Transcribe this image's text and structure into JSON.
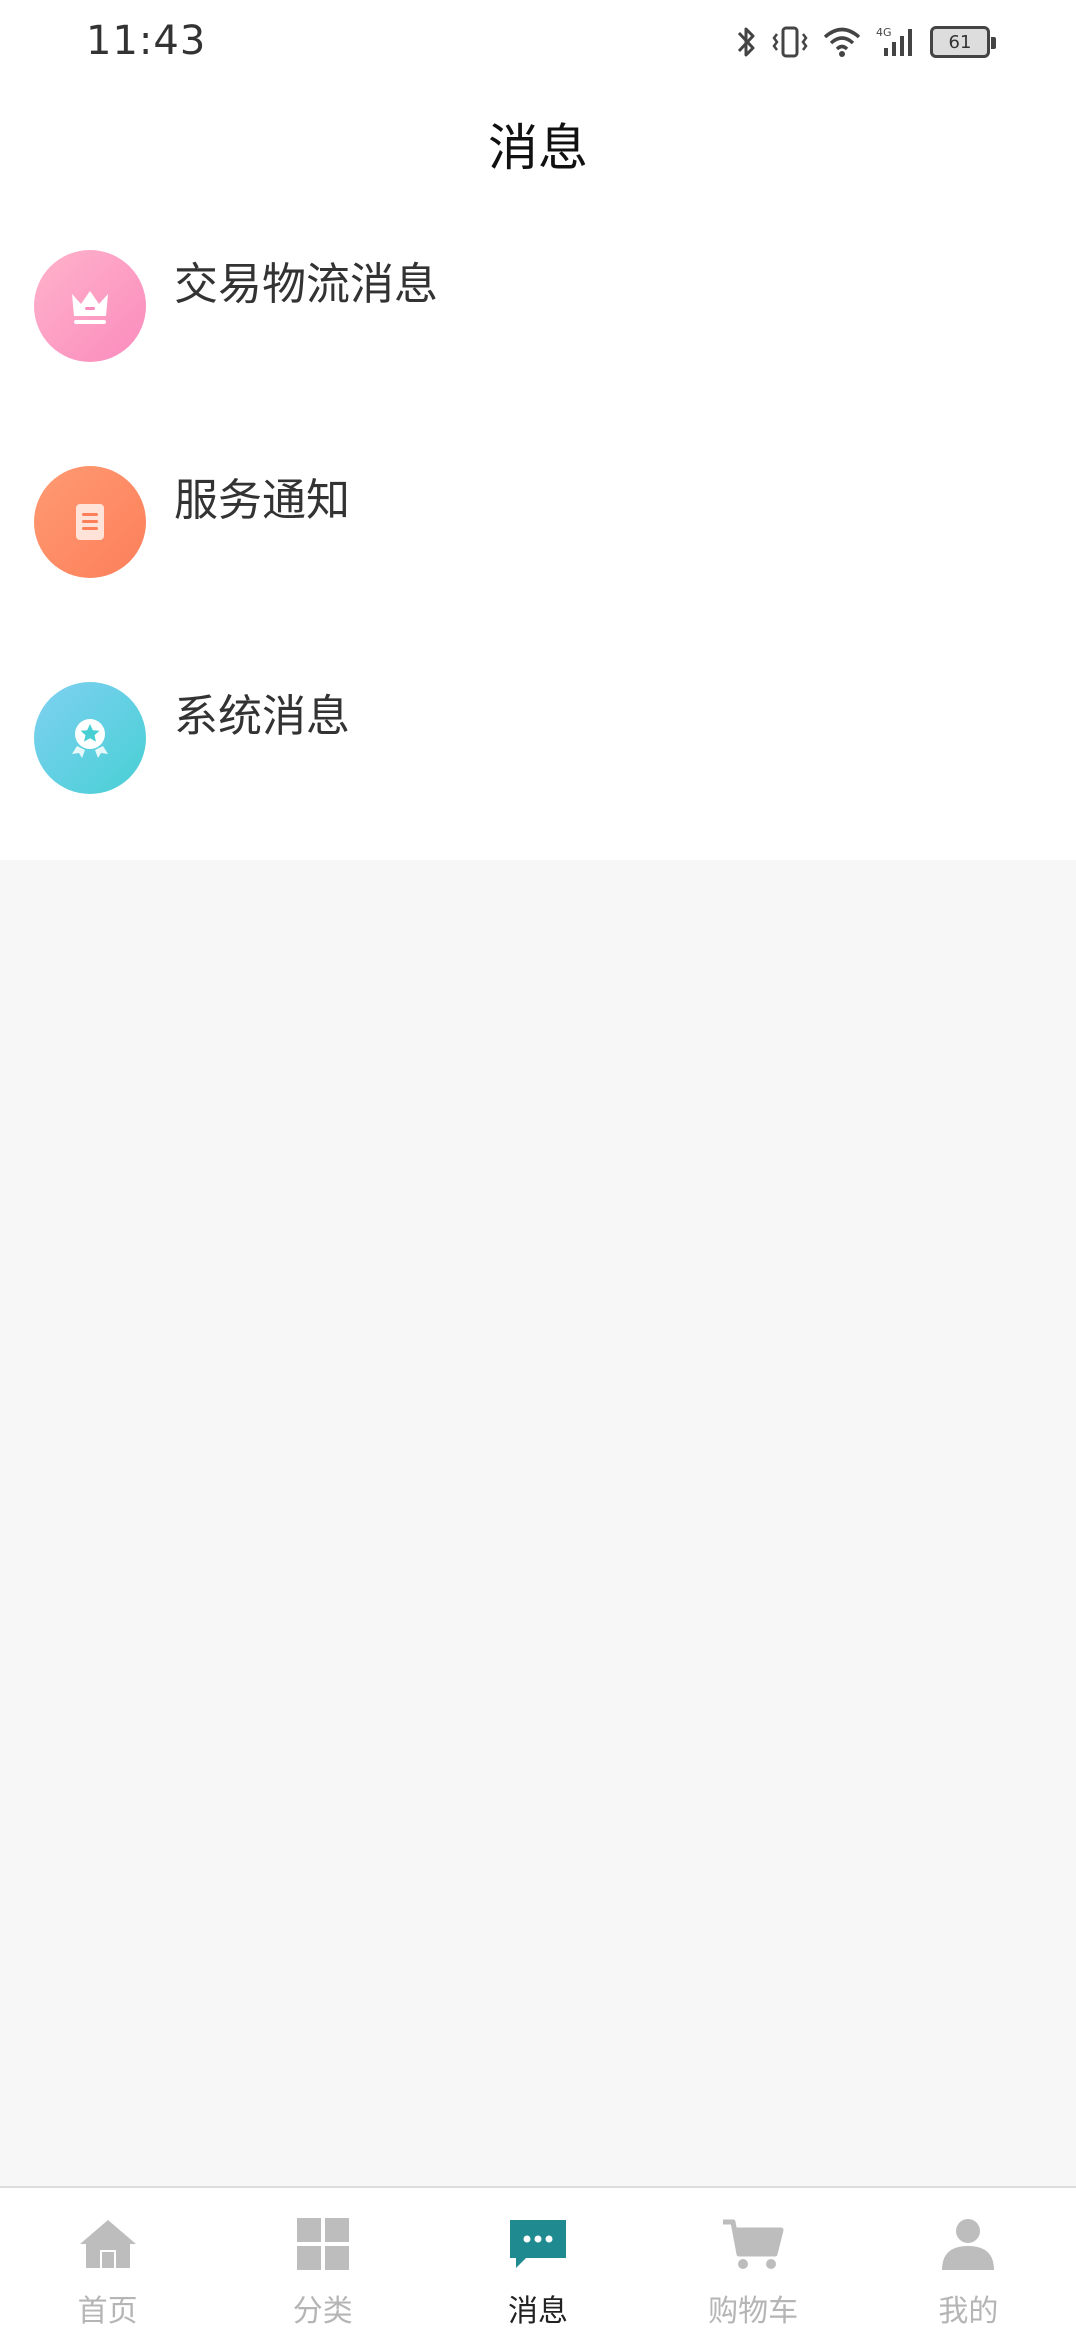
{
  "status_bar": {
    "time": "11:43",
    "network": "4G",
    "battery": "61"
  },
  "header": {
    "title": "消息"
  },
  "messages": [
    {
      "label": "交易物流消息",
      "icon": "crown-icon",
      "color": "#fb8bbd"
    },
    {
      "label": "服务通知",
      "icon": "book-icon",
      "color": "#fc7f5a"
    },
    {
      "label": "系统消息",
      "icon": "medal-icon",
      "color": "#47cfd4"
    }
  ],
  "tab_bar": {
    "active_color": "#1f8a8f",
    "inactive_color": "#bdbdbd",
    "tabs": [
      {
        "label": "首页",
        "icon": "home-icon",
        "active": false
      },
      {
        "label": "分类",
        "icon": "grid-icon",
        "active": false
      },
      {
        "label": "消息",
        "icon": "chat-icon",
        "active": true
      },
      {
        "label": "购物车",
        "icon": "cart-icon",
        "active": false
      },
      {
        "label": "我的",
        "icon": "user-icon",
        "active": false
      }
    ]
  }
}
